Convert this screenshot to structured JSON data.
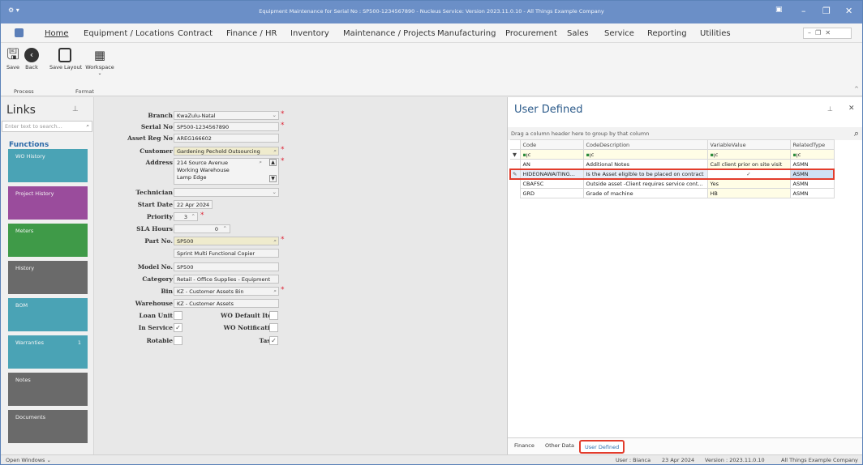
{
  "window": {
    "title": "Equipment Maintenance for Serial No : SP500-1234567890 - Nucleus Service: Version 2023.11.0.10 - All Things Example Company"
  },
  "menu": [
    "Home",
    "Equipment / Locations",
    "Contract",
    "Finance / HR",
    "Inventory",
    "Maintenance / Projects",
    "Manufacturing",
    "Procurement",
    "Sales",
    "Service",
    "Reporting",
    "Utilities"
  ],
  "ribbon": {
    "save": "Save",
    "back": "Back",
    "save_layout": "Save Layout",
    "workspace": "Workspace",
    "group_process": "Process",
    "group_format": "Format"
  },
  "links": {
    "title": "Links",
    "search_placeholder": "Enter text to search...",
    "functions": "Functions",
    "tiles": [
      {
        "label": "WO History",
        "color": "#4aa3b5",
        "badge": ""
      },
      {
        "label": "Project History",
        "color": "#9a4c9c",
        "badge": ""
      },
      {
        "label": "Meters",
        "color": "#3f9a48",
        "badge": ""
      },
      {
        "label": "History",
        "color": "#6a6a6a",
        "badge": ""
      },
      {
        "label": "BOM",
        "color": "#4aa3b5",
        "badge": ""
      },
      {
        "label": "Warranties",
        "color": "#4aa3b5",
        "badge": "1"
      },
      {
        "label": "Notes",
        "color": "#6a6a6a",
        "badge": ""
      },
      {
        "label": "Documents",
        "color": "#6a6a6a",
        "badge": ""
      }
    ]
  },
  "form": {
    "branch_label": "Branch",
    "branch": "KwaZulu-Natal",
    "serial_label": "Serial No",
    "serial": "SP500-1234567890",
    "assetreg_label": "Asset Reg No",
    "assetreg": "AREG166602",
    "customer_label": "Customer",
    "customer": "Gardening Pechold Outsourcing",
    "address_label": "Address",
    "address1": "214 Source Avenue",
    "address2": "Working Warehouse",
    "address3": "Lamp Edge",
    "technician_label": "Technician",
    "technician": "",
    "startdate_label": "Start Date",
    "startdate": "22 Apr 2024",
    "priority_label": "Priority",
    "priority": "3",
    "sla_label": "SLA Hours",
    "sla": "0",
    "partno_label": "Part No.",
    "partno": "SP500",
    "part_desc": "Sprint Multi Functional Copier",
    "model_label": "Model No.",
    "model": "SP500",
    "category_label": "Category",
    "category": "Retail - Office Supplies - Equipment",
    "bin_label": "Bin",
    "bin": "KZ - Customer Assets Bin",
    "warehouse_label": "Warehouse",
    "warehouse": "KZ - Customer Assets",
    "loan_label": "Loan Unit",
    "loan_checked": false,
    "wodefault_label": "WO Default Item",
    "wodefault_checked": false,
    "inservice_label": "In Service",
    "inservice_checked": true,
    "wonotif_label": "WO Notification",
    "wonotif_checked": false,
    "rotable_label": "Rotable",
    "rotable_checked": false,
    "tasks_label": "Tasks",
    "tasks_checked": true
  },
  "user_defined": {
    "title": "User Defined",
    "group_hint": "Drag a column header here to group by that column",
    "columns": [
      "Code",
      "CodeDescription",
      "VariableValue",
      "RelatedType"
    ],
    "rows": [
      {
        "code": "AN",
        "desc": "Additional Notes",
        "value": "Call client prior on site visit",
        "type": "ASMN",
        "checked": false
      },
      {
        "code": "HIDEONAWAITING...",
        "desc": "Is the Asset eligible to be placed on contract",
        "value": "",
        "type": "ASMN",
        "checked": true
      },
      {
        "code": "CBAFSC",
        "desc": "Outside asset -Client requires service cont...",
        "value": "Yes",
        "type": "ASMN",
        "checked": false
      },
      {
        "code": "GRD",
        "desc": "Grade of machine",
        "value": "HB",
        "type": "ASMN",
        "checked": false
      }
    ],
    "tabs": [
      "Finance",
      "Other Data",
      "User Defined"
    ]
  },
  "status": {
    "open_windows": "Open Windows",
    "user": "User : Bianca",
    "date": "23 Apr 2024",
    "version": "Version : 2023.11.0.10",
    "company": "All Things Example Company"
  },
  "colors": {
    "accent": "#6b8fc7",
    "highlight": "#e23c2c"
  }
}
